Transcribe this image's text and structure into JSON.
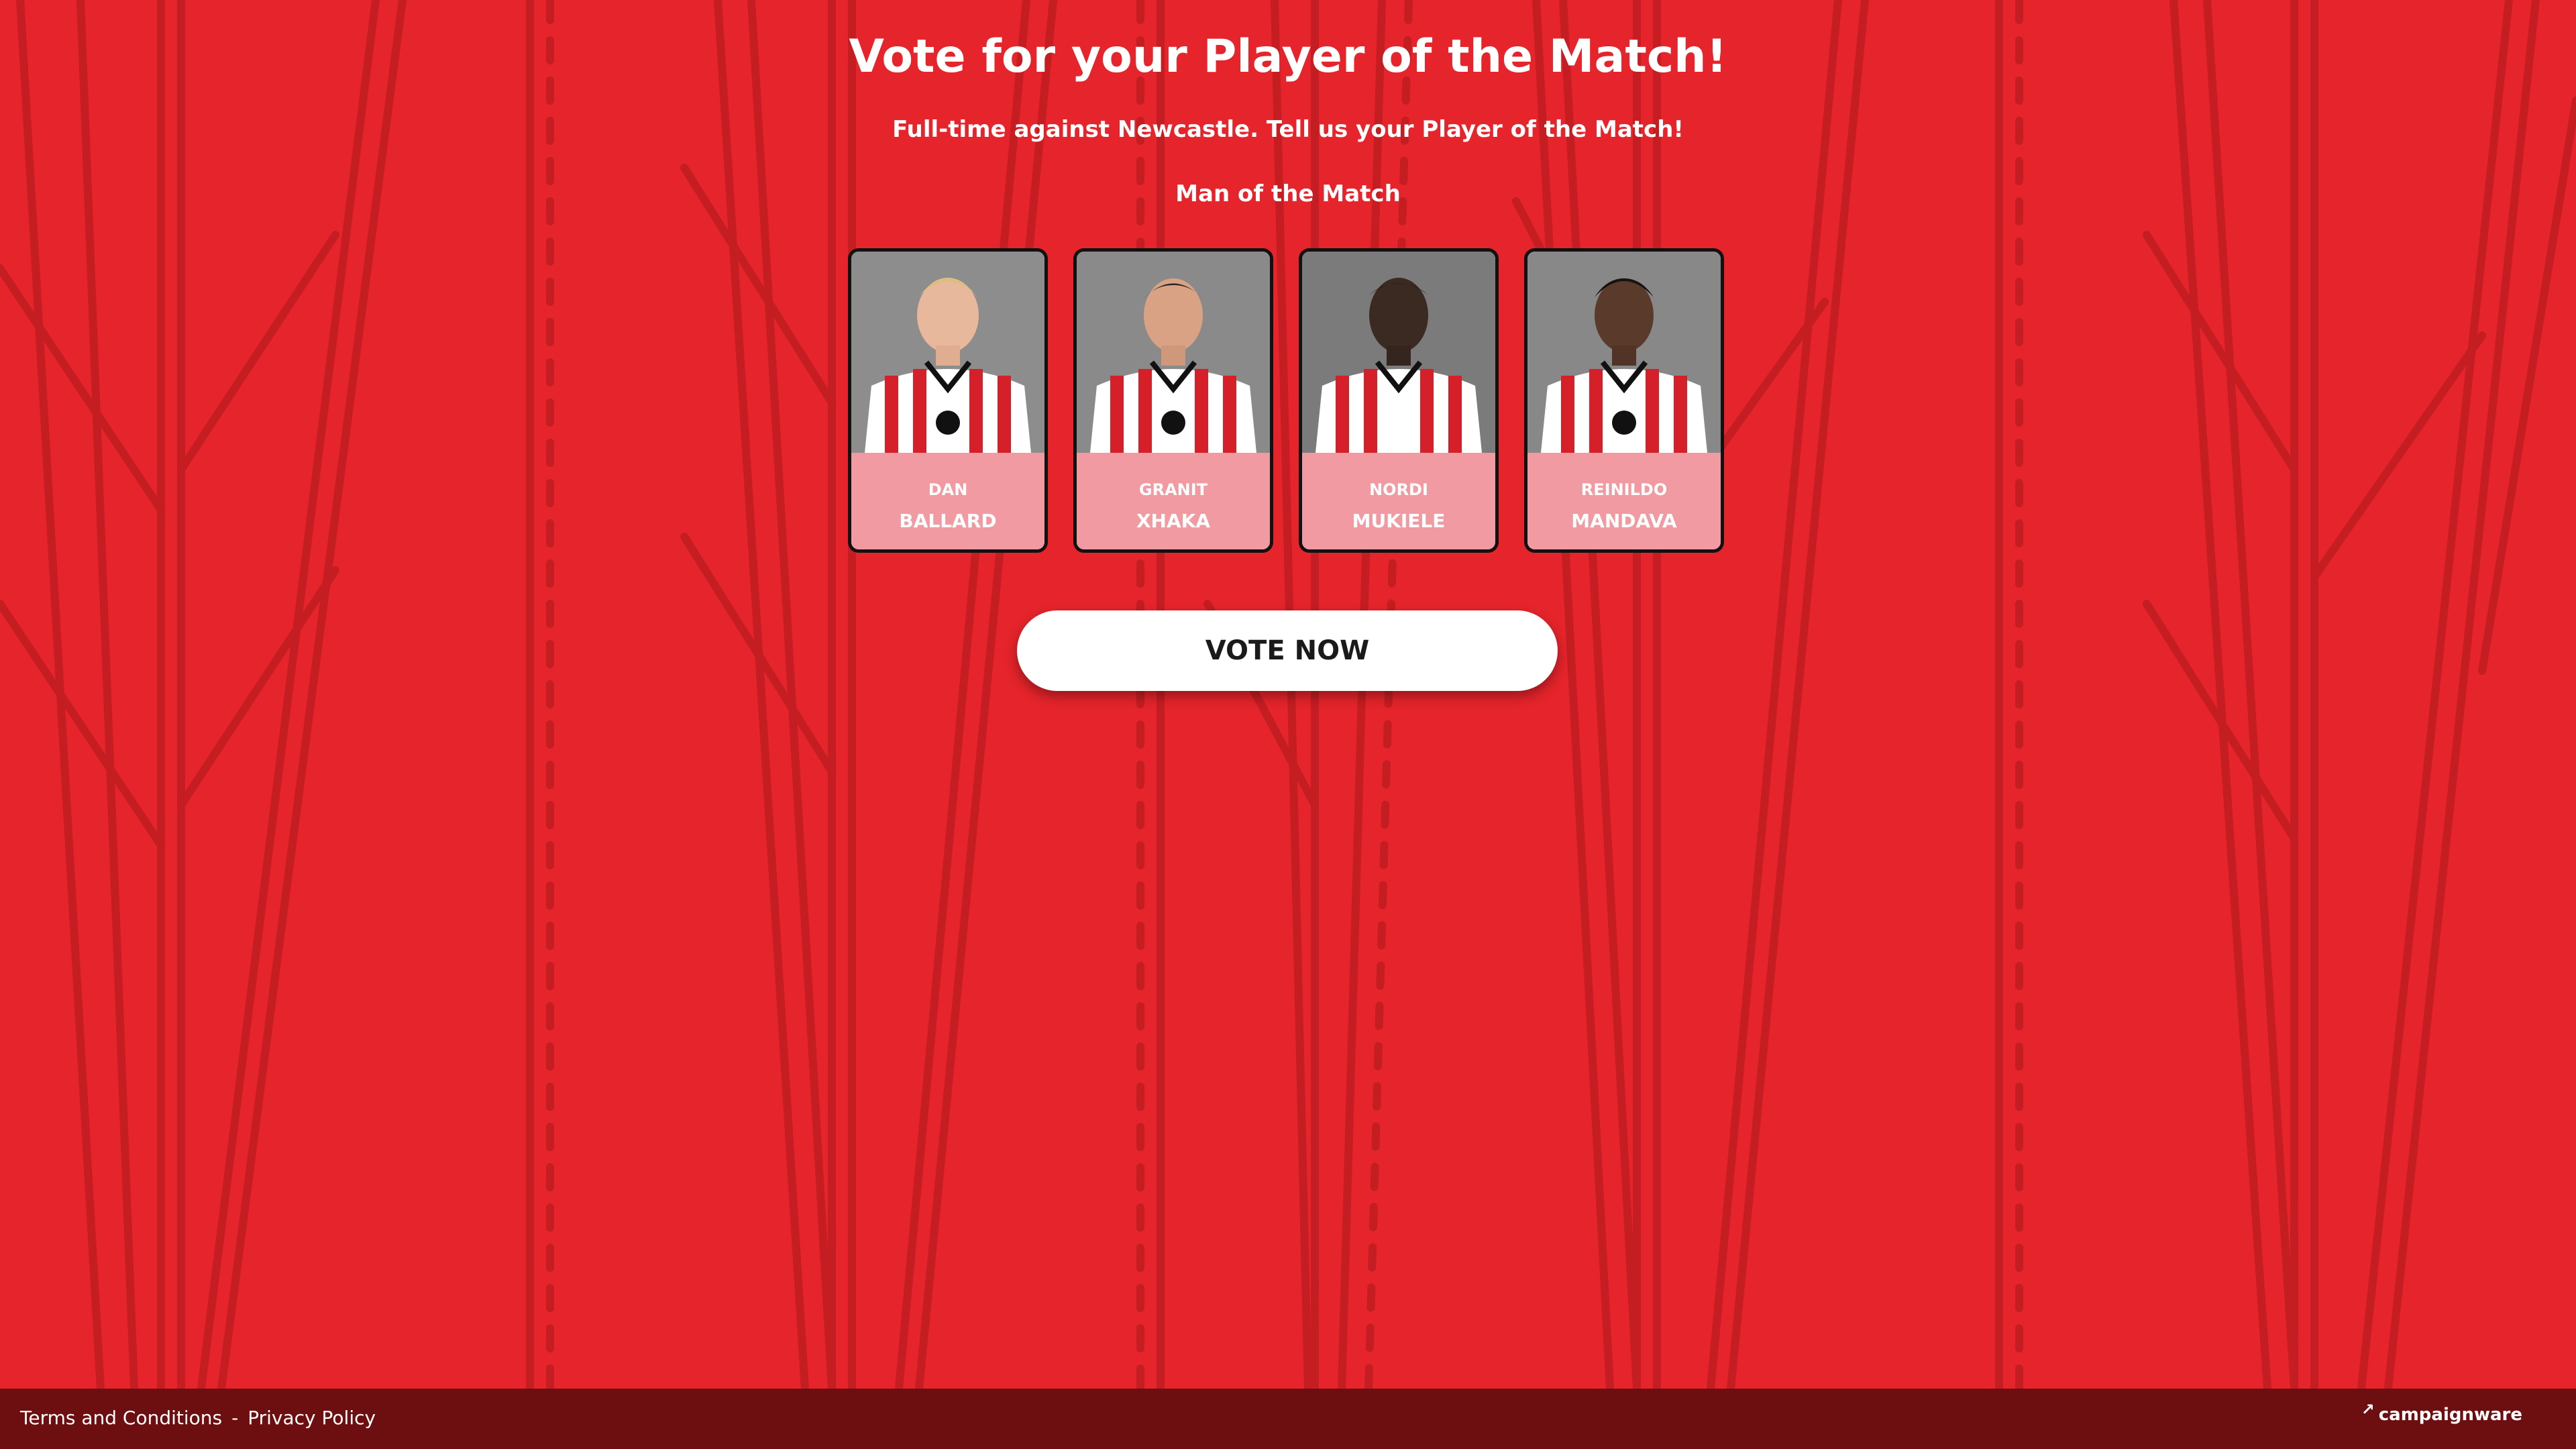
{
  "page": {
    "title": "Vote for your Player of the Match!",
    "subtitle": "Full-time against Newcastle. Tell us your Player of the Match!",
    "section_label": "Man of the Match"
  },
  "players": [
    {
      "first": "DAN",
      "last": "BALLARD"
    },
    {
      "first": "GRANIT",
      "last": "XHAKA"
    },
    {
      "first": "NORDI",
      "last": "MUKIELE"
    },
    {
      "first": "REINILDO",
      "last": "MANDAVA"
    }
  ],
  "vote_button": {
    "label": "VOTE NOW"
  },
  "footer": {
    "terms": "Terms and Conditions",
    "separator": "-",
    "privacy": "Privacy Policy",
    "brand": "campaignware"
  },
  "colors": {
    "background": "#e5242b",
    "pattern_line": "#c41d22",
    "card_panel": "#f19aa1",
    "footer": "#6d0e11"
  }
}
